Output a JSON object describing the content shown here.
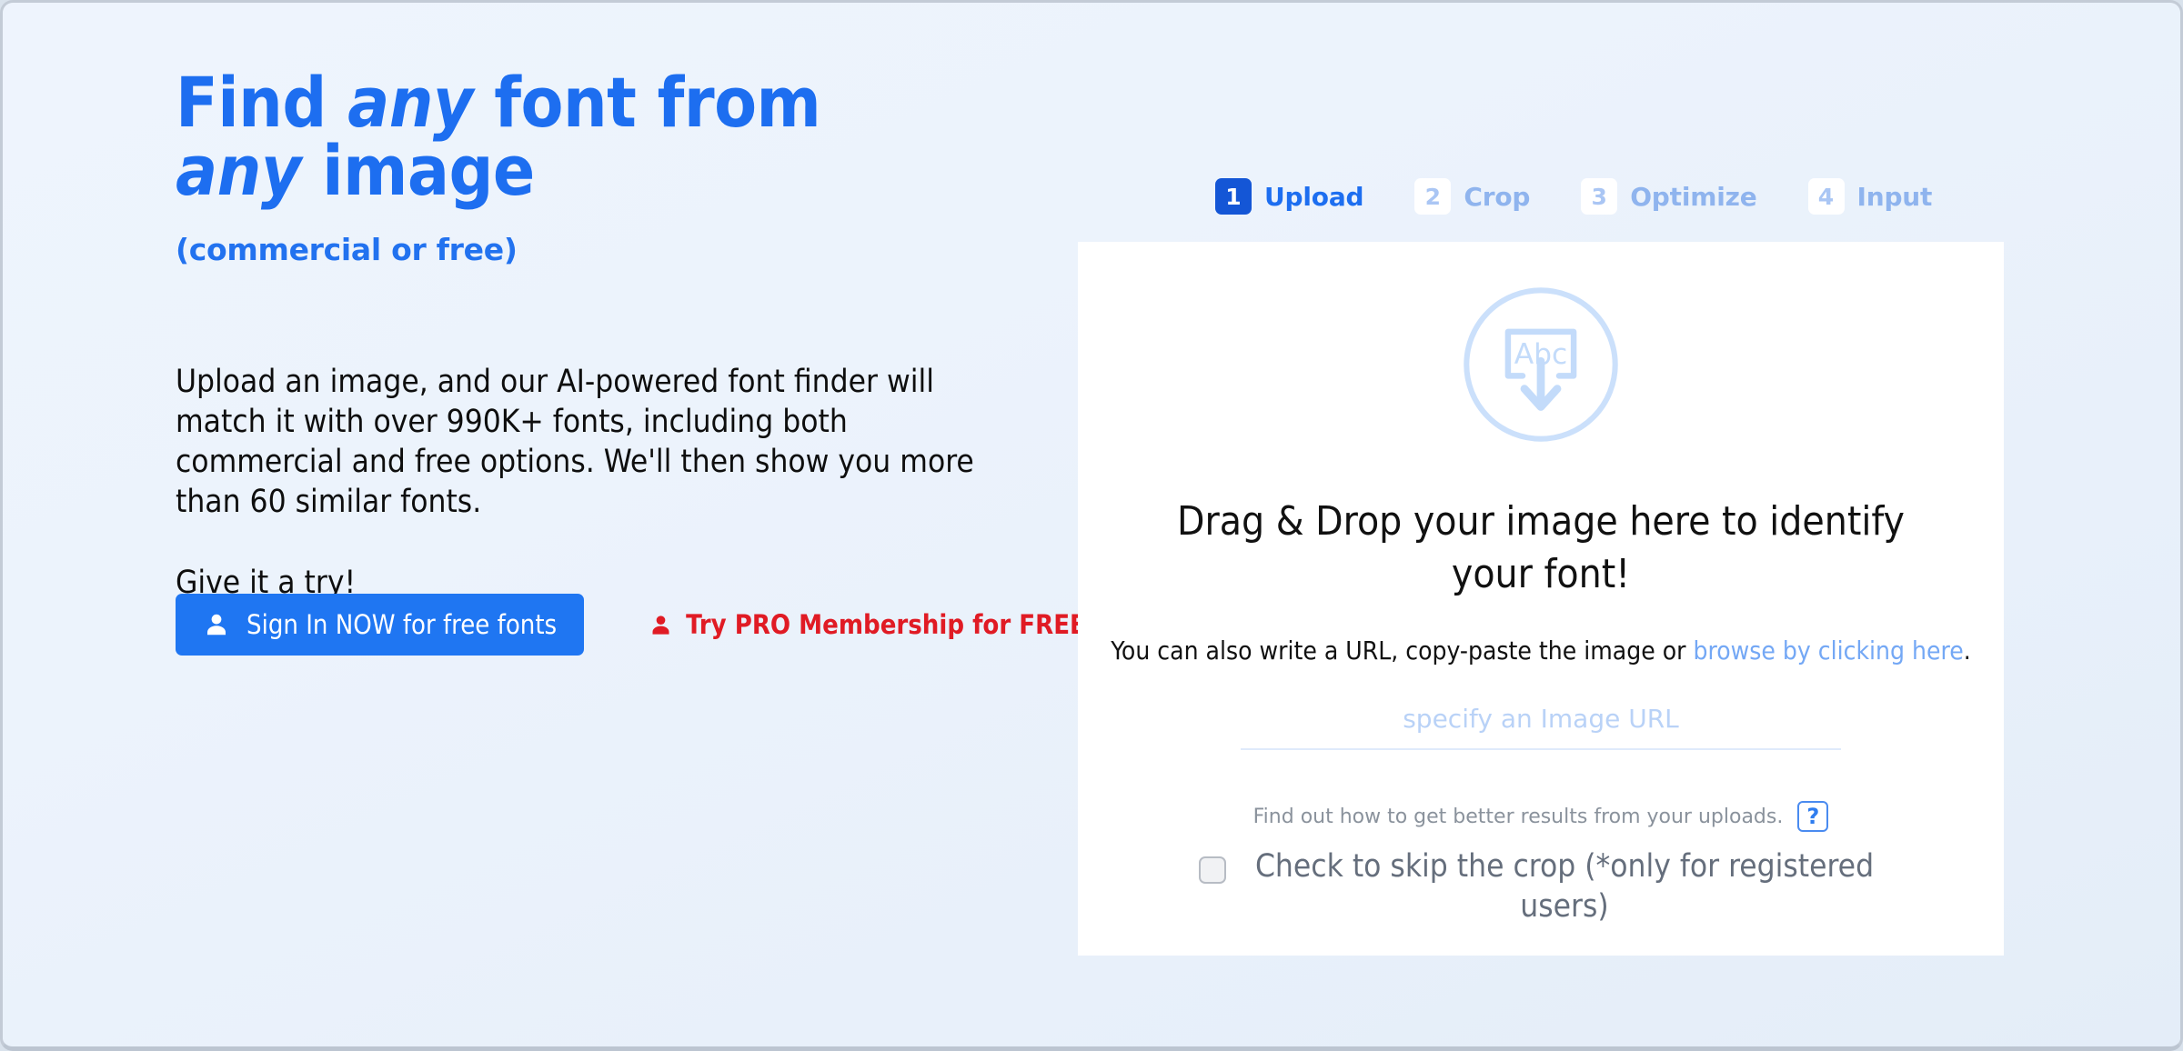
{
  "hero": {
    "heading_part1": "Find ",
    "heading_em1": "any",
    "heading_part2": " font from ",
    "heading_em2": "any",
    "heading_part3": " image",
    "subtitle": "(commercial or free)",
    "paragraph": "Upload an image, and our AI-powered font finder will match it with over 990K+ fonts, including both commercial and free options. We'll then show you more than 60 similar fonts.",
    "try_line": "Give it a try!"
  },
  "cta": {
    "signin_label": "Sign In NOW for free fonts",
    "signin_icon": "person-icon",
    "signin_color": "#1f76f2",
    "pro_label": "Try PRO Membership for FREE!",
    "pro_icon": "person-icon",
    "pro_color": "#e01b24"
  },
  "stepper": {
    "steps": [
      {
        "number": "1",
        "label": "Upload",
        "state": "active"
      },
      {
        "number": "2",
        "label": "Crop",
        "state": "inactive"
      },
      {
        "number": "3",
        "label": "Optimize",
        "state": "inactive"
      },
      {
        "number": "4",
        "label": "Input",
        "state": "inactive"
      }
    ],
    "active_bg": "#1456d6",
    "inactive_bg": "#ffffff"
  },
  "upload_card": {
    "icon_name": "abc-image-download-icon",
    "icon_text": "Abc",
    "icon_color": "#c3dbfa",
    "drop_heading": "Drag & Drop your image here to identify your font!",
    "url_hint_before": "You can also write a URL, copy-paste the image or ",
    "url_hint_link": "browse by clicking here",
    "url_hint_after": ".",
    "url_input_placeholder": "specify an Image URL",
    "url_input_value": "",
    "help_text": "Find out how to get better results from your uploads.",
    "help_button_label": "?",
    "skip_crop_label": "Check to skip the crop (*only for registered users)",
    "skip_crop_checked": false
  },
  "theme": {
    "background_start": "#eef4fd",
    "background_end": "#e4edf8",
    "accent_blue": "#1d6ef0",
    "link_blue": "#74a8f5",
    "red": "#e01b24",
    "card_bg": "#ffffff"
  }
}
